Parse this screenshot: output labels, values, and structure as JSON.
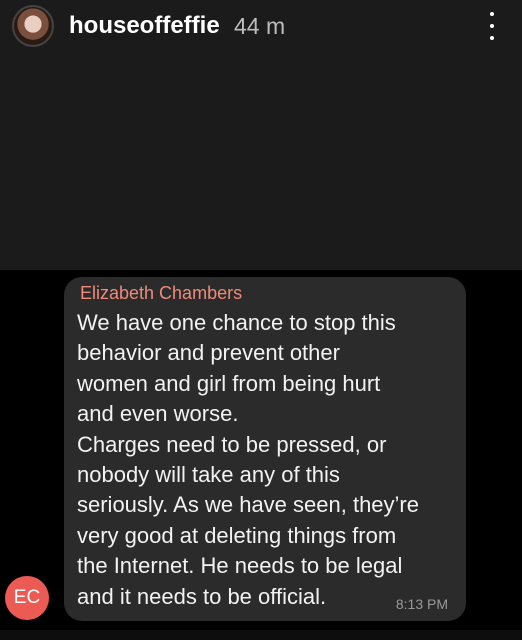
{
  "story": {
    "username": "houseoffeffie",
    "time_ago": "44 m"
  },
  "message": {
    "sender": "Elizabeth Chambers",
    "text": "We have one chance to stop this\nbehavior and prevent other\nwomen and girl from being hurt\nand even worse.\nCharges need to be pressed, or\nnobody will take any of this\nseriously. As we have seen, they’re\nvery good at deleting things from\nthe Internet. He needs to be legal\nand it needs to be official.",
    "time": "8:13 PM",
    "avatar_initials": "EC"
  },
  "colors": {
    "sender": "#f08a7a",
    "avatar_bg": "#ec5a54",
    "bubble_bg": "#2b2b2b"
  }
}
